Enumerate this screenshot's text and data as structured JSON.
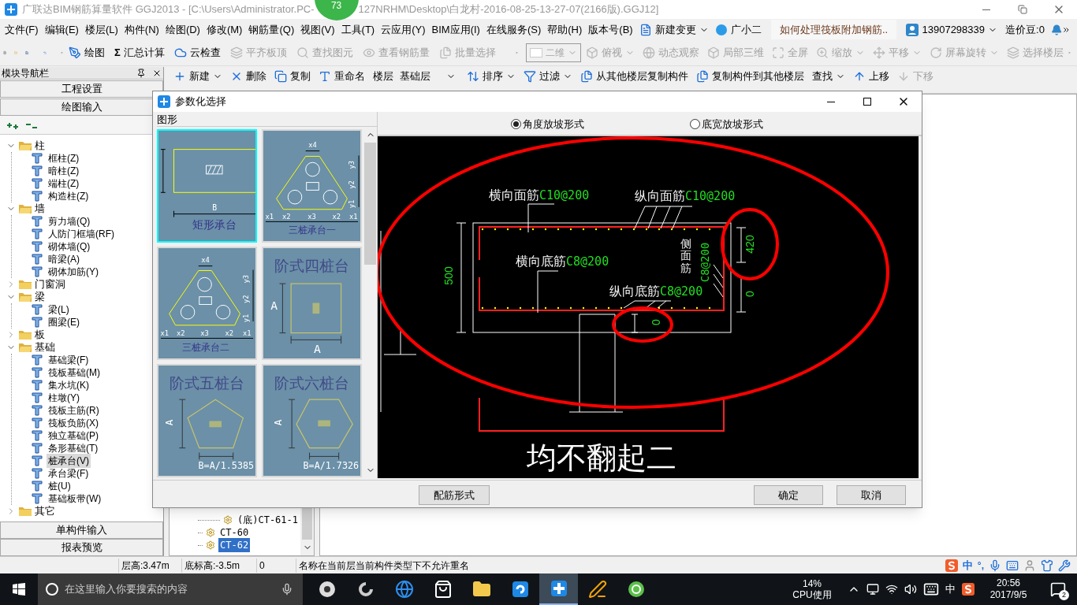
{
  "window": {
    "title_left": "广联达BIM钢筋算量软件 GGJ2013 - [C:\\Users\\Administrator.PC-",
    "title_right": "127NRHM\\Desktop\\白龙村-2016-08-25-13-27-07(2166版).GGJ12]",
    "badge": "73"
  },
  "menu": [
    "文件(F)",
    "编辑(E)",
    "楼层(L)",
    "构件(N)",
    "绘图(D)",
    "修改(M)",
    "钢筋量(Q)",
    "视图(V)",
    "工具(T)",
    "云应用(Y)",
    "BIM应用(I)",
    "在线服务(S)",
    "帮助(H)",
    "版本号(B)"
  ],
  "menu_extras": {
    "new_change": "新建变更",
    "assistant": "广小二",
    "question": "如何处理筏板附加钢筋..",
    "account": "13907298339",
    "beans": "造价豆:0"
  },
  "toolbar1": [
    {
      "label": "绘图",
      "disabled": false
    },
    {
      "label": "汇总计算",
      "icon_text": "Σ",
      "disabled": false
    },
    {
      "label": "云检查",
      "disabled": false
    },
    {
      "label": "平齐板顶",
      "disabled": true
    },
    {
      "label": "查找图元",
      "disabled": true
    },
    {
      "label": "查看钢筋量",
      "disabled": true
    },
    {
      "label": "批量选择",
      "disabled": true
    }
  ],
  "view_toolbar": {
    "mode": "二维",
    "disabled": true,
    "items": [
      {
        "label": "俯视",
        "dropdown": true,
        "disabled": true
      },
      {
        "label": "动态观察",
        "dropdown": false,
        "disabled": true
      },
      {
        "label": "局部三维",
        "dropdown": false,
        "disabled": true
      },
      {
        "label": "全屏",
        "dropdown": false,
        "disabled": true
      },
      {
        "label": "缩放",
        "dropdown": true,
        "disabled": true
      },
      {
        "label": "平移",
        "dropdown": true,
        "disabled": true
      },
      {
        "label": "屏幕旋转",
        "dropdown": true,
        "disabled": true
      },
      {
        "label": "选择楼层",
        "dropdown": false,
        "disabled": true
      }
    ]
  },
  "toolbar2": [
    {
      "kind": "button",
      "label": "新建",
      "dropdown": true,
      "disabled": false
    },
    {
      "kind": "button",
      "label": "删除",
      "dropdown": false,
      "disabled": false
    },
    {
      "kind": "button",
      "label": "复制",
      "dropdown": false,
      "disabled": false
    },
    {
      "kind": "button",
      "label": "重命名",
      "dropdown": false,
      "disabled": false
    },
    {
      "kind": "floor",
      "label": "楼层",
      "value": "基础层"
    },
    {
      "kind": "button",
      "label": "排序",
      "dropdown": true,
      "disabled": false
    },
    {
      "kind": "button",
      "label": "过滤",
      "dropdown": true,
      "disabled": false
    },
    {
      "kind": "button",
      "label": "从其他楼层复制构件",
      "dropdown": false,
      "disabled": false
    },
    {
      "kind": "button",
      "label": "复制构件到其他楼层",
      "dropdown": false,
      "disabled": false
    },
    {
      "kind": "button",
      "label": "查找",
      "dropdown": true,
      "disabled": false
    },
    {
      "kind": "button",
      "label": "上移",
      "dropdown": false,
      "disabled": false
    },
    {
      "kind": "button",
      "label": "下移",
      "dropdown": false,
      "disabled": true
    }
  ],
  "sidebar": {
    "title": "模块导航栏",
    "top_buttons": [
      "工程设置",
      "绘图输入"
    ],
    "bottom_buttons": [
      "单构件输入",
      "报表预览"
    ],
    "tree": [
      {
        "label": "柱",
        "expanded": true,
        "children": [
          {
            "label": "框柱(Z)",
            "selected": false
          },
          {
            "label": "暗柱(Z)",
            "selected": false
          },
          {
            "label": "端柱(Z)",
            "selected": false
          },
          {
            "label": "构造柱(Z)",
            "selected": false
          }
        ]
      },
      {
        "label": "墙",
        "expanded": true,
        "children": [
          {
            "label": "剪力墙(Q)",
            "selected": false
          },
          {
            "label": "人防门框墙(RF)",
            "selected": false
          },
          {
            "label": "砌体墙(Q)",
            "selected": false
          },
          {
            "label": "暗梁(A)",
            "selected": false
          },
          {
            "label": "砌体加筋(Y)",
            "selected": false
          }
        ]
      },
      {
        "label": "门窗洞",
        "expanded": false
      },
      {
        "label": "梁",
        "expanded": true,
        "children": [
          {
            "label": "梁(L)",
            "selected": false
          },
          {
            "label": "圈梁(E)",
            "selected": false
          }
        ]
      },
      {
        "label": "板",
        "expanded": false
      },
      {
        "label": "基础",
        "expanded": true,
        "children": [
          {
            "label": "基础梁(F)",
            "selected": false
          },
          {
            "label": "筏板基础(M)",
            "selected": false
          },
          {
            "label": "集水坑(K)",
            "selected": false
          },
          {
            "label": "柱墩(Y)",
            "selected": false
          },
          {
            "label": "筏板主筋(R)",
            "selected": false
          },
          {
            "label": "筏板负筋(X)",
            "selected": false
          },
          {
            "label": "独立基础(P)",
            "selected": false
          },
          {
            "label": "条形基础(T)",
            "selected": false
          },
          {
            "label": "桩承台(V)",
            "selected": true
          },
          {
            "label": "承台梁(F)",
            "selected": false
          },
          {
            "label": "桩(U)",
            "selected": false
          },
          {
            "label": "基础板带(W)",
            "selected": false
          }
        ]
      },
      {
        "label": "其它",
        "expanded": false
      }
    ]
  },
  "component_list": [
    {
      "label": "(底)CT-61-1",
      "selected": false,
      "indent": true
    },
    {
      "label": "CT-60",
      "selected": false,
      "indent": false
    },
    {
      "label": "CT-62",
      "selected": true,
      "indent": false
    }
  ],
  "dialog": {
    "title": "参数化选择",
    "group": "图形",
    "options": [
      {
        "label": "角度放坡形式",
        "selected": true
      },
      {
        "label": "底宽放坡形式",
        "selected": false
      }
    ],
    "shapes": [
      {
        "kind": "rect",
        "title": "矩形承台",
        "selected": true,
        "labels": [
          "B"
        ]
      },
      {
        "kind": "tri1",
        "title": "三桩承台一",
        "selected": false,
        "labels": [
          "x4",
          "y3",
          "y2",
          "y1",
          "x1",
          "x2",
          "x3",
          "x2",
          "x1"
        ]
      },
      {
        "kind": "tri2",
        "title": "三桩承台二",
        "selected": false,
        "labels": [
          "x4",
          "y3",
          "y2",
          "y1",
          "x1",
          "x2",
          "x3",
          "x2",
          "x1"
        ]
      },
      {
        "kind": "square",
        "title": "阶式四桩台",
        "selected": false,
        "labels": [
          "A",
          "A"
        ]
      },
      {
        "kind": "pentagon",
        "title": "阶式五桩台",
        "selected": false,
        "labels": [
          "A",
          "B=A/1.5385"
        ]
      },
      {
        "kind": "hexagon",
        "title": "阶式六桩台",
        "selected": false,
        "labels": [
          "A",
          "B=A/1.7326"
        ]
      }
    ],
    "drawing": {
      "labels": [
        {
          "name": "横向面筋",
          "spec": "C10@200"
        },
        {
          "name": "纵向面筋",
          "spec": "C10@200"
        },
        {
          "name": "横向底筋",
          "spec": "C8@200"
        },
        {
          "name": "纵向底筋",
          "spec": "C8@200"
        }
      ],
      "side": {
        "name": "侧面筋",
        "spec": "C8@200"
      },
      "dims": [
        "500",
        "420",
        "0",
        "0"
      ],
      "caption": "均不翻起二"
    },
    "buttons": [
      "配筋形式",
      "确定",
      "取消"
    ]
  },
  "status_bar": [
    "层高:3.47m",
    "底标高:-3.5m",
    "0",
    "名称在当前层当前构件类型下不允许重名"
  ],
  "ime": {
    "mode": "中",
    "punct": "°,"
  },
  "taskbar": {
    "search_placeholder": "在这里输入你要搜索的内容",
    "cpu": "14%",
    "cpu_label": "CPU使用",
    "ime": "中",
    "time": "20:56",
    "date": "2017/9/5",
    "notifications": "2"
  }
}
